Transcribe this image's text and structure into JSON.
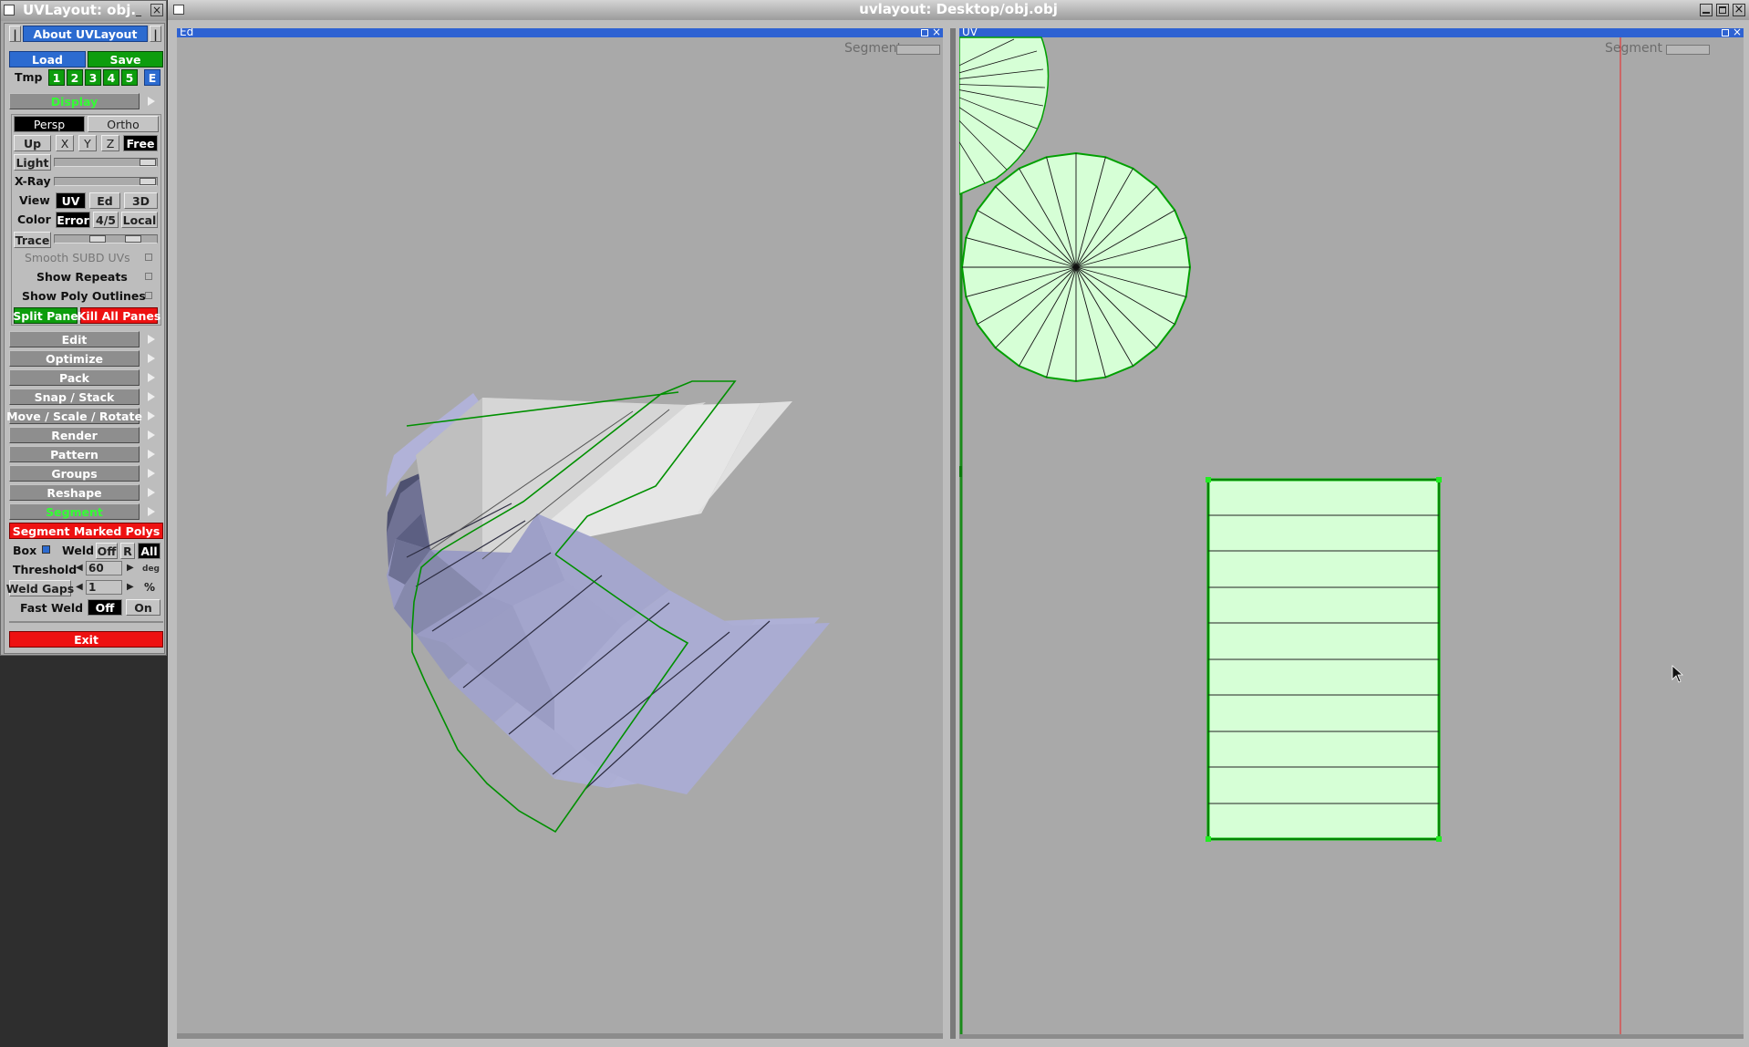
{
  "panel": {
    "title": "UVLayout: obj.",
    "about": "About UVLayout",
    "load": "Load",
    "save": "Save",
    "tmp": "Tmp",
    "slots": [
      "1",
      "2",
      "3",
      "4",
      "5",
      "E"
    ],
    "display": "Display",
    "persp": "Persp",
    "ortho": "Ortho",
    "up": "Up",
    "axes": [
      "X",
      "Y",
      "Z"
    ],
    "free": "Free",
    "light": "Light",
    "xray": "X-Ray",
    "view": "View",
    "view_uv": "UV",
    "view_ed": "Ed",
    "view_3d": "3D",
    "color": "Color",
    "color_error": "Error",
    "color_45": "4/5",
    "color_local": "Local",
    "trace": "Trace",
    "smooth": "Smooth SUBD UVs",
    "show_repeats": "Show Repeats",
    "show_poly": "Show Poly Outlines",
    "split": "Split Pane",
    "kill": "Kill All Panes",
    "menus": [
      "Edit",
      "Optimize",
      "Pack",
      "Snap / Stack",
      "Move / Scale / Rotate",
      "Render",
      "Pattern",
      "Groups",
      "Reshape",
      "Segment"
    ],
    "segment_marked": "Segment Marked Polys",
    "box": "Box",
    "weld": "Weld",
    "off": "Off",
    "r": "R",
    "all": "All",
    "threshold": "Threshold",
    "threshold_val": "60",
    "deg": "deg",
    "weld_gaps": "Weld Gaps",
    "weld_gaps_val": "1",
    "pct": "%",
    "fast_weld": "Fast Weld",
    "fast_off": "Off",
    "fast_on": "On",
    "exit": "Exit"
  },
  "main_window": {
    "title": "uvlayout: Desktop/obj.obj"
  },
  "pane_ed": {
    "label": "Ed",
    "segment": "Segment"
  },
  "pane_uv": {
    "label": "UV",
    "segment": "Segment"
  },
  "colors": {
    "viewport": "#a9a9a9",
    "titlebar": "#2e62d2",
    "uv_fill": "#d6ffd6",
    "uv_edge": "#00a000",
    "mesh_fill": "#9c9ed0",
    "accent_red": "#ee1111",
    "accent_green": "#0d9d0d"
  }
}
